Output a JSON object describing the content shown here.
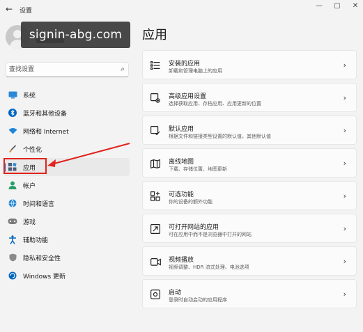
{
  "window": {
    "title": "设置",
    "back_glyph": "←",
    "controls": [
      "—",
      "▢",
      "✕"
    ]
  },
  "watermark": "signin-abg.com",
  "search": {
    "placeholder": "查找设置"
  },
  "sidebar": {
    "items": [
      {
        "label": "系统",
        "icon": "system-icon",
        "color": "#0067c0"
      },
      {
        "label": "蓝牙和其他设备",
        "icon": "bluetooth-icon",
        "color": "#0067c0"
      },
      {
        "label": "网络和 Internet",
        "icon": "wifi-icon",
        "color": "#0067c0"
      },
      {
        "label": "个性化",
        "icon": "brush-icon",
        "color": "#c0632b"
      },
      {
        "label": "应用",
        "icon": "apps-icon",
        "color": "#4d5b7a",
        "active": true
      },
      {
        "label": "帐户",
        "icon": "account-icon",
        "color": "#2a9d6a"
      },
      {
        "label": "时间和语言",
        "icon": "globe-clock-icon",
        "color": "#0067c0"
      },
      {
        "label": "游戏",
        "icon": "gamepad-icon",
        "color": "#6b6b6b"
      },
      {
        "label": "辅助功能",
        "icon": "accessibility-icon",
        "color": "#0067c0"
      },
      {
        "label": "隐私和安全性",
        "icon": "shield-icon",
        "color": "#6b6b6b"
      },
      {
        "label": "Windows 更新",
        "icon": "update-icon",
        "color": "#0067c0"
      }
    ]
  },
  "main": {
    "title": "应用",
    "cards": [
      {
        "title": "安装的应用",
        "desc": "卸载和管理电脑上的应用",
        "icon": "installed-apps-icon"
      },
      {
        "title": "高级应用设置",
        "desc": "选择获取应用、存档应用、应用更新的位置",
        "icon": "advanced-apps-icon"
      },
      {
        "title": "默认应用",
        "desc": "根据文件和链接类型设置的默认值，其他默认值",
        "icon": "default-apps-icon"
      },
      {
        "title": "离线地图",
        "desc": "下载、存储位置、地图更新",
        "icon": "map-icon"
      },
      {
        "title": "可选功能",
        "desc": "你的设备的额外功能",
        "icon": "optional-features-icon"
      },
      {
        "title": "可打开网站的应用",
        "desc": "可在应用中而不是浏览器中打开的网站",
        "icon": "apps-for-websites-icon"
      },
      {
        "title": "视频播放",
        "desc": "视频调整、HDR 流式处理、电池选项",
        "icon": "video-icon"
      },
      {
        "title": "启动",
        "desc": "登录时自动启动的应用程序",
        "icon": "startup-icon"
      }
    ]
  },
  "annotation": {
    "color": "#e0231d"
  }
}
